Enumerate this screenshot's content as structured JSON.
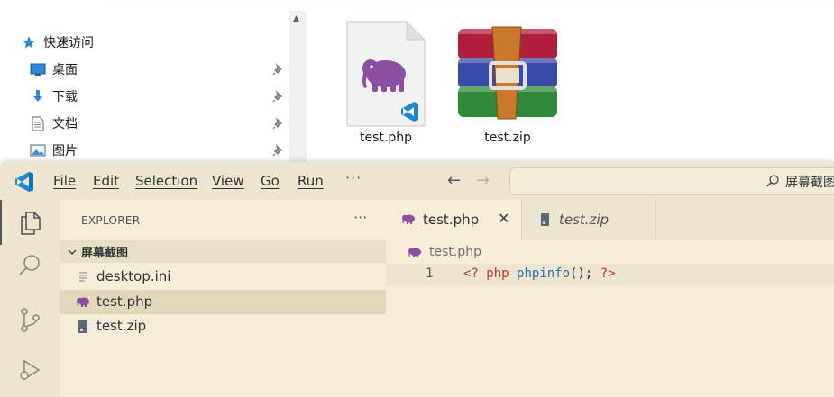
{
  "file_explorer": {
    "nav_items": [
      {
        "label": "快速访问",
        "icon": "star-icon"
      },
      {
        "label": "桌面",
        "icon": "desktop-icon",
        "pinned": true
      },
      {
        "label": "下载",
        "icon": "download-icon",
        "pinned": true
      },
      {
        "label": "文档",
        "icon": "document-icon",
        "pinned": true
      },
      {
        "label": "图片",
        "icon": "picture-icon",
        "pinned": true
      }
    ],
    "files": [
      {
        "name": "test.php",
        "icon": "php-file-icon"
      },
      {
        "name": "test.zip",
        "icon": "winrar-archive-icon"
      }
    ]
  },
  "vscode": {
    "menu": [
      "File",
      "Edit",
      "Selection",
      "View",
      "Go",
      "Run"
    ],
    "menu_more": "···",
    "search_text": "屏幕截图",
    "sidebar": {
      "title": "EXPLORER",
      "more": "···",
      "folder_name": "屏幕截图",
      "files": [
        {
          "name": "desktop.ini",
          "icon": "text-file-icon"
        },
        {
          "name": "test.php",
          "icon": "php-elephant-icon",
          "selected": true
        },
        {
          "name": "test.zip",
          "icon": "zip-file-icon"
        }
      ]
    },
    "tabs": [
      {
        "label": "test.php",
        "active": true,
        "close": "✕"
      },
      {
        "label": "test.zip",
        "active": false
      }
    ],
    "breadcrumb": "test.php",
    "code": {
      "line_number": "1",
      "tokens": [
        {
          "text": "<?",
          "color": "#c0392b"
        },
        {
          "text": " ",
          "color": "#333333"
        },
        {
          "text": "php",
          "color": "#c0392b"
        },
        {
          "text": " ",
          "color": "#333333"
        },
        {
          "text": "phpinfo",
          "color": "#2a6fb5"
        },
        {
          "text": "();",
          "color": "#333333"
        },
        {
          "text": " ",
          "color": "#333333"
        },
        {
          "text": "?>",
          "color": "#c0392b"
        }
      ]
    }
  },
  "colors": {
    "accent_purple": "#8a4fa3",
    "vscode_blue": "#1a8ad4",
    "editor_bg": "#f5edd7"
  }
}
